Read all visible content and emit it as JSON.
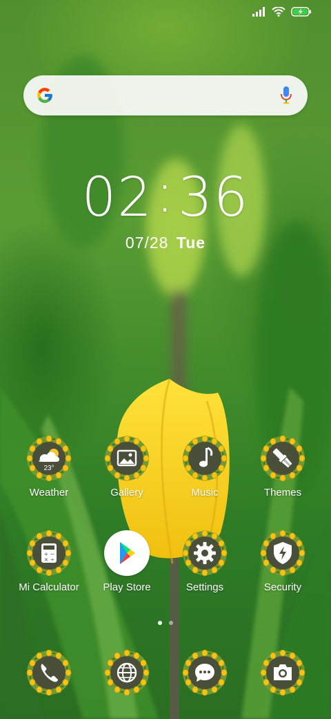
{
  "status_bar": {
    "signal_icon": "signal-bars-icon",
    "wifi_icon": "wifi-icon",
    "battery_icon": "battery-charging-icon"
  },
  "search": {
    "logo_icon": "google-g-icon",
    "voice_icon": "microphone-icon"
  },
  "clock": {
    "hours": "02",
    "separator": ":",
    "minutes": "36",
    "date": "07/28",
    "day": "Tue"
  },
  "apps_row1": [
    {
      "label": "Weather",
      "icon": "weather-cloud-sun-icon",
      "badge": "23°"
    },
    {
      "label": "Gallery",
      "icon": "gallery-image-icon"
    },
    {
      "label": "Music",
      "icon": "music-note-icon"
    },
    {
      "label": "Themes",
      "icon": "themes-brush-icon"
    }
  ],
  "apps_row2": [
    {
      "label": "Mi Calculator",
      "icon": "calculator-icon"
    },
    {
      "label": "Play Store",
      "icon": "play-store-icon"
    },
    {
      "label": "Settings",
      "icon": "settings-gear-icon"
    },
    {
      "label": "Security",
      "icon": "security-shield-icon"
    }
  ],
  "dock": [
    {
      "icon": "phone-icon"
    },
    {
      "icon": "browser-globe-icon"
    },
    {
      "icon": "messaging-icon"
    },
    {
      "icon": "camera-icon"
    }
  ],
  "pager": {
    "pages": 2,
    "active": 1
  },
  "colors": {
    "icon_bg": "#4a4f3a",
    "flower_yellow": "#f2c418",
    "leaf_green": "#4c8a23"
  }
}
